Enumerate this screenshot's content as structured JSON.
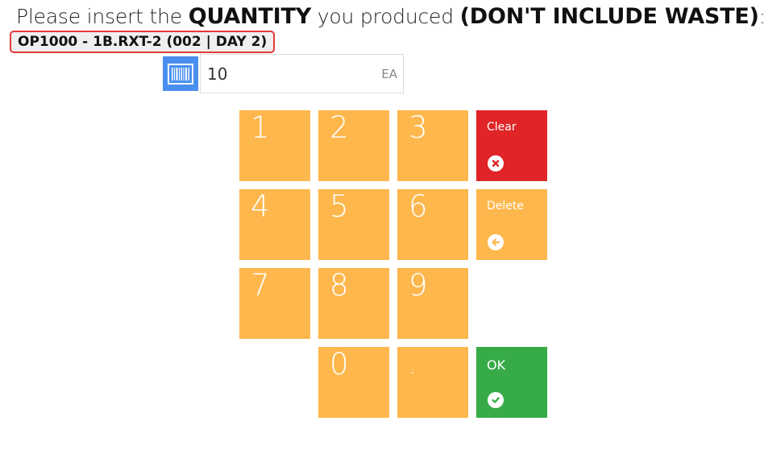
{
  "prompt": {
    "part1": "Please insert the ",
    "part2": "QUANTITY",
    "part3": " you produced ",
    "part4": "(DON'T INCLUDE WASTE)",
    "part5": ":"
  },
  "operation_label": "OP1000 - 1B.RXT-2 (002 | DAY 2)",
  "quantity": {
    "value": "10",
    "unit": "EA"
  },
  "keypad": {
    "digits": [
      "1",
      "2",
      "3",
      "4",
      "5",
      "6",
      "7",
      "8",
      "9",
      "0",
      "."
    ],
    "clear_label": "Clear",
    "delete_label": "Delete",
    "ok_label": "OK"
  },
  "colors": {
    "key": "#fdb74c",
    "clear": "#e02427",
    "ok": "#37ab48",
    "scan": "#4a8ff0",
    "highlight_border": "#e53935"
  },
  "icons": {
    "scan": "barcode-icon",
    "clear": "close-circle-icon",
    "delete": "arrow-left-circle-icon",
    "ok": "check-circle-icon"
  }
}
